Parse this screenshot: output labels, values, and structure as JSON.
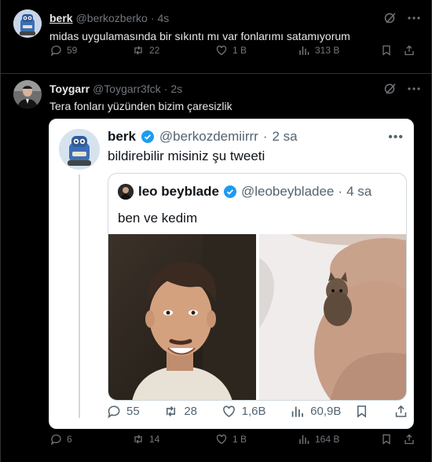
{
  "colors": {
    "background": "#000000",
    "divider": "#2f3336",
    "text_primary": "#e7e9ea",
    "text_secondary": "#71767b",
    "verified_blue": "#1d9bf0"
  },
  "tweet1": {
    "name": "berk",
    "handle": "@berkozberko",
    "separator": "·",
    "time": "4s",
    "text": "midas uygulamasında bir sıkıntı mı var fonlarımı satamıyorum",
    "actions": {
      "reply_count": "59",
      "retweet_count": "22",
      "like_count": "1 B",
      "view_count": "313 B"
    }
  },
  "tweet2": {
    "name": "Toygarr",
    "handle": "@Toygarr3fck",
    "separator": "·",
    "time": "2s",
    "text": "Tera fonları yüzünden bizim çaresizlik",
    "actions": {
      "reply_count": "6",
      "retweet_count": "14",
      "like_count": "1 B",
      "view_count": "164 B"
    },
    "embedded": {
      "name": "berk",
      "handle": "@berkozdemiirrr",
      "separator": "·",
      "time": "2 sa",
      "text": "bildirebilir misiniz şu tweeti",
      "quote": {
        "name": "leo beyblade",
        "handle": "@leobeybladee",
        "separator": "·",
        "time": "4 sa",
        "text": "ben ve kedim"
      },
      "actions": {
        "reply_count": "55",
        "retweet_count": "28",
        "like_count": "1,6B",
        "view_count": "60,9B"
      }
    }
  }
}
